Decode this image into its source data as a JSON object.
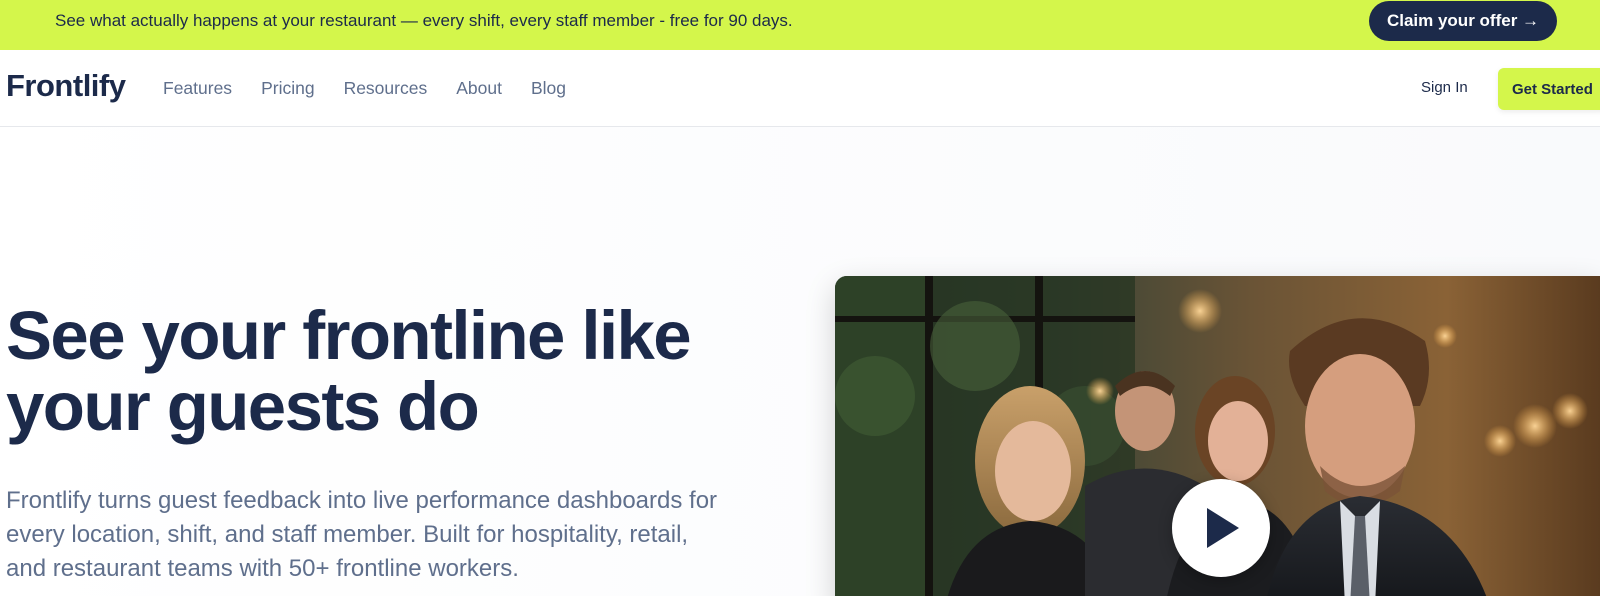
{
  "promo": {
    "text": "See what actually happens at your restaurant — every shift, every staff member - free for 90 days.",
    "cta_label": "Claim your offer →"
  },
  "nav": {
    "logo": "Frontlify",
    "links": [
      "Features",
      "Pricing",
      "Resources",
      "About",
      "Blog"
    ],
    "sign_in": "Sign In",
    "get_started": "Get Started"
  },
  "hero": {
    "title": "See your frontline like your guests do",
    "description": "Frontlify turns guest feedback into live performance dashboards for every location, shift, and staff member. Built for hospitality, retail, and restaurant teams with 50+ frontline workers."
  },
  "video": {
    "play_icon": "play-icon"
  },
  "colors": {
    "accent": "#d4f64b",
    "navy": "#1c2a4a",
    "muted_text": "#5f6f8c"
  }
}
